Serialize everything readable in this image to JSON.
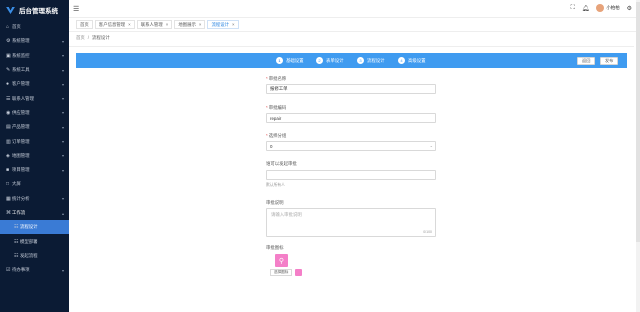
{
  "app": {
    "title": "后台管理系统"
  },
  "sidebar": {
    "items": [
      {
        "label": "首页",
        "icon": "home-icon"
      },
      {
        "label": "系统管理",
        "icon": "gear-icon",
        "chev": "▾"
      },
      {
        "label": "系统监控",
        "icon": "monitor-icon",
        "chev": "▾"
      },
      {
        "label": "系统工具",
        "icon": "tool-icon",
        "chev": "▾"
      },
      {
        "label": "客户管理",
        "icon": "user-icon",
        "chev": "▾"
      },
      {
        "label": "联系人管理",
        "icon": "contact-icon",
        "chev": "▾"
      },
      {
        "label": "供应管理",
        "icon": "supply-icon",
        "chev": "▾"
      },
      {
        "label": "产品管理",
        "icon": "product-icon",
        "chev": "▾"
      },
      {
        "label": "订单管理",
        "icon": "order-icon",
        "chev": "▾"
      },
      {
        "label": "地图管理",
        "icon": "map-icon",
        "chev": "▾"
      },
      {
        "label": "项目管理",
        "icon": "project-icon",
        "chev": "▾"
      },
      {
        "label": "大屏",
        "icon": "screen-icon"
      },
      {
        "label": "统计分析",
        "icon": "chart-icon",
        "chev": "▾"
      },
      {
        "label": "工作流",
        "icon": "workflow-icon",
        "chev": "▴"
      },
      {
        "label": "流程设计",
        "icon": "design-icon"
      },
      {
        "label": "模型部署",
        "icon": "deploy-icon"
      },
      {
        "label": "发起流程",
        "icon": "start-icon"
      },
      {
        "label": "待办事项",
        "icon": "todo-icon",
        "chev": "▾"
      }
    ]
  },
  "header": {
    "username": "小柏柏"
  },
  "tabs": [
    {
      "label": "首页"
    },
    {
      "label": "客户信息管理"
    },
    {
      "label": "联系人管理"
    },
    {
      "label": "地图展示"
    },
    {
      "label": "流程设计"
    }
  ],
  "breadcrumb": {
    "home": "首页",
    "sep": "/",
    "current": "流程设计"
  },
  "steps": [
    {
      "num": "1",
      "label": "基础设置"
    },
    {
      "num": "2",
      "label": "表单设计"
    },
    {
      "num": "3",
      "label": "流程设计"
    },
    {
      "num": "4",
      "label": "高级设置"
    }
  ],
  "actions": {
    "back": "返回",
    "publish": "发布"
  },
  "form": {
    "name_label": "审批名称",
    "name_value": "报修工单",
    "code_label": "审批编码",
    "code_value": "repair",
    "group_label": "选择分组",
    "group_value": "0",
    "initiator_label": "谁可以发起审批",
    "initiator_hint": "默认所有人",
    "desc_label": "审批说明",
    "desc_placeholder": "请输入审批说明",
    "desc_count": "0/100",
    "icon_label": "审批图标",
    "icon_button": "选择图标"
  },
  "colors": {
    "sidebar": "#0b1b34",
    "accent": "#3f9bf0",
    "active": "#3a7bd5",
    "icon_pink": "#f47fc8"
  }
}
